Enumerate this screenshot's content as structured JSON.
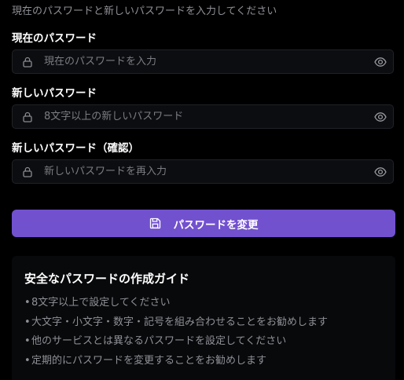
{
  "form": {
    "subtitle": "現在のパスワードと新しいパスワードを入力してください",
    "current_password": {
      "label": "現在のパスワード",
      "placeholder": "現在のパスワードを入力"
    },
    "new_password": {
      "label": "新しいパスワード",
      "placeholder": "8文字以上の新しいパスワード"
    },
    "confirm_password": {
      "label": "新しいパスワード（確認）",
      "placeholder": "新しいパスワードを再入力"
    },
    "submit_label": "パスワードを変更"
  },
  "guide": {
    "title": "安全なパスワードの作成ガイド",
    "bullet": "•",
    "items": [
      "8文字以上で設定してください",
      "大文字・小文字・数字・記号を組み合わせることをお勧めします",
      "他のサービスとは異なるパスワードを設定してください",
      "定期的にパスワードを変更することをお勧めします"
    ]
  },
  "icons": {
    "field_prefix": "lock-icon",
    "field_suffix": "eye-icon",
    "submit": "save-icon"
  },
  "colors": {
    "background": "#000000",
    "input_background": "#0c0d10",
    "input_border": "#202228",
    "primary_button": "#7251cf",
    "muted_text": "#8f9096",
    "heading_text": "#ffffff"
  }
}
